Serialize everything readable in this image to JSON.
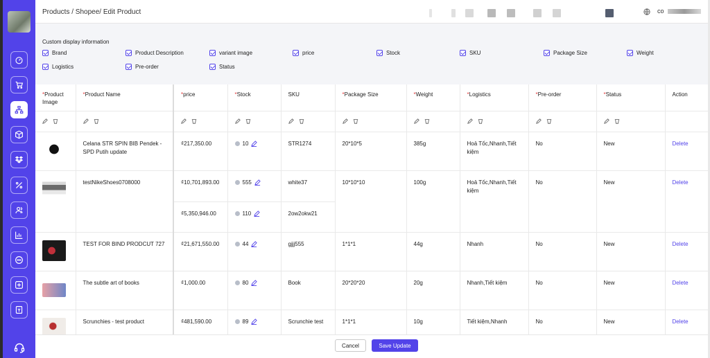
{
  "topbar": {
    "breadcrumb": "Products / Shopee/ Edit Product",
    "user_label": "co"
  },
  "sidebar": {
    "items": [
      {
        "icon": "dashboard-icon"
      },
      {
        "icon": "cart-icon"
      },
      {
        "icon": "sitemap-icon",
        "active": true
      },
      {
        "icon": "box-icon"
      },
      {
        "icon": "dropbox-icon"
      },
      {
        "icon": "percent-icon"
      },
      {
        "icon": "users-icon"
      },
      {
        "icon": "chart-icon"
      },
      {
        "icon": "chat-icon"
      },
      {
        "icon": "plus-square-icon"
      },
      {
        "icon": "receipt-icon"
      }
    ],
    "support_icon": "headset-icon"
  },
  "display_options": {
    "title": "Custom display information",
    "checkboxes": [
      {
        "label": "Brand",
        "checked": true
      },
      {
        "label": "Product Description",
        "checked": true
      },
      {
        "label": "variant image",
        "checked": true
      },
      {
        "label": "price",
        "checked": true
      },
      {
        "label": "Stock",
        "checked": true
      },
      {
        "label": "SKU",
        "checked": true
      },
      {
        "label": "Package Size",
        "checked": true
      },
      {
        "label": "Weight",
        "checked": true
      },
      {
        "label": "Logistics",
        "checked": true
      },
      {
        "label": "Pre-order",
        "checked": true
      },
      {
        "label": "Status",
        "checked": true
      }
    ]
  },
  "table": {
    "headers": {
      "image": "Product Image",
      "name": "Product Name",
      "price": "price",
      "stock": "Stock",
      "sku": "SKU",
      "package": "Package Size",
      "weight": "Weight",
      "logistics": "Logistics",
      "preorder": "Pre-order",
      "status": "Status",
      "action": "Action"
    },
    "rows": [
      {
        "name": "Celana STR SPIN BIB Pendek - SPD Putih update",
        "variants": [
          {
            "price": "₫217,350.00",
            "stock": "10",
            "sku": "STR1274"
          }
        ],
        "package": "20*10*5",
        "weight": "385g",
        "logistics": "Hoả Tốc,Nhanh,Tiết kiệm",
        "preorder": "No",
        "status": "New",
        "action": "Delete"
      },
      {
        "name": "testNikeShoes0708000",
        "variants": [
          {
            "price": "₫10,701,893.00",
            "stock": "555",
            "sku": "white37"
          },
          {
            "price": "₫5,350,946.00",
            "stock": "110",
            "sku": "2ow2okw21"
          }
        ],
        "package": "10*10*10",
        "weight": "100g",
        "logistics": "Hoả Tốc,Nhanh,Tiết kiệm",
        "preorder": "No",
        "status": "New",
        "action": "Delete"
      },
      {
        "name": "TEST FOR BIND PRODCUT 727",
        "variants": [
          {
            "price": "₫21,671,550.00",
            "stock": "44",
            "sku": "gjjj555"
          }
        ],
        "package": "1*1*1",
        "weight": "44g",
        "logistics": "Nhanh",
        "preorder": "No",
        "status": "New",
        "action": "Delete"
      },
      {
        "name": "The subtle art of books",
        "variants": [
          {
            "price": "₫1,000.00",
            "stock": "80",
            "sku": "Book"
          }
        ],
        "package": "20*20*20",
        "weight": "20g",
        "logistics": "Nhanh,Tiết kiệm",
        "preorder": "No",
        "status": "New",
        "action": "Delete"
      },
      {
        "name": "Scrunchies - test product",
        "variants": [
          {
            "price": "₫481,590.00",
            "stock": "89",
            "sku": "Scrunchie test"
          }
        ],
        "package": "1*1*1",
        "weight": "10g",
        "logistics": "Tiết kiệm,Nhanh",
        "preorder": "No",
        "status": "New",
        "action": "Delete"
      }
    ]
  },
  "footer": {
    "cancel_label": "Cancel",
    "save_label": "Save Update"
  }
}
